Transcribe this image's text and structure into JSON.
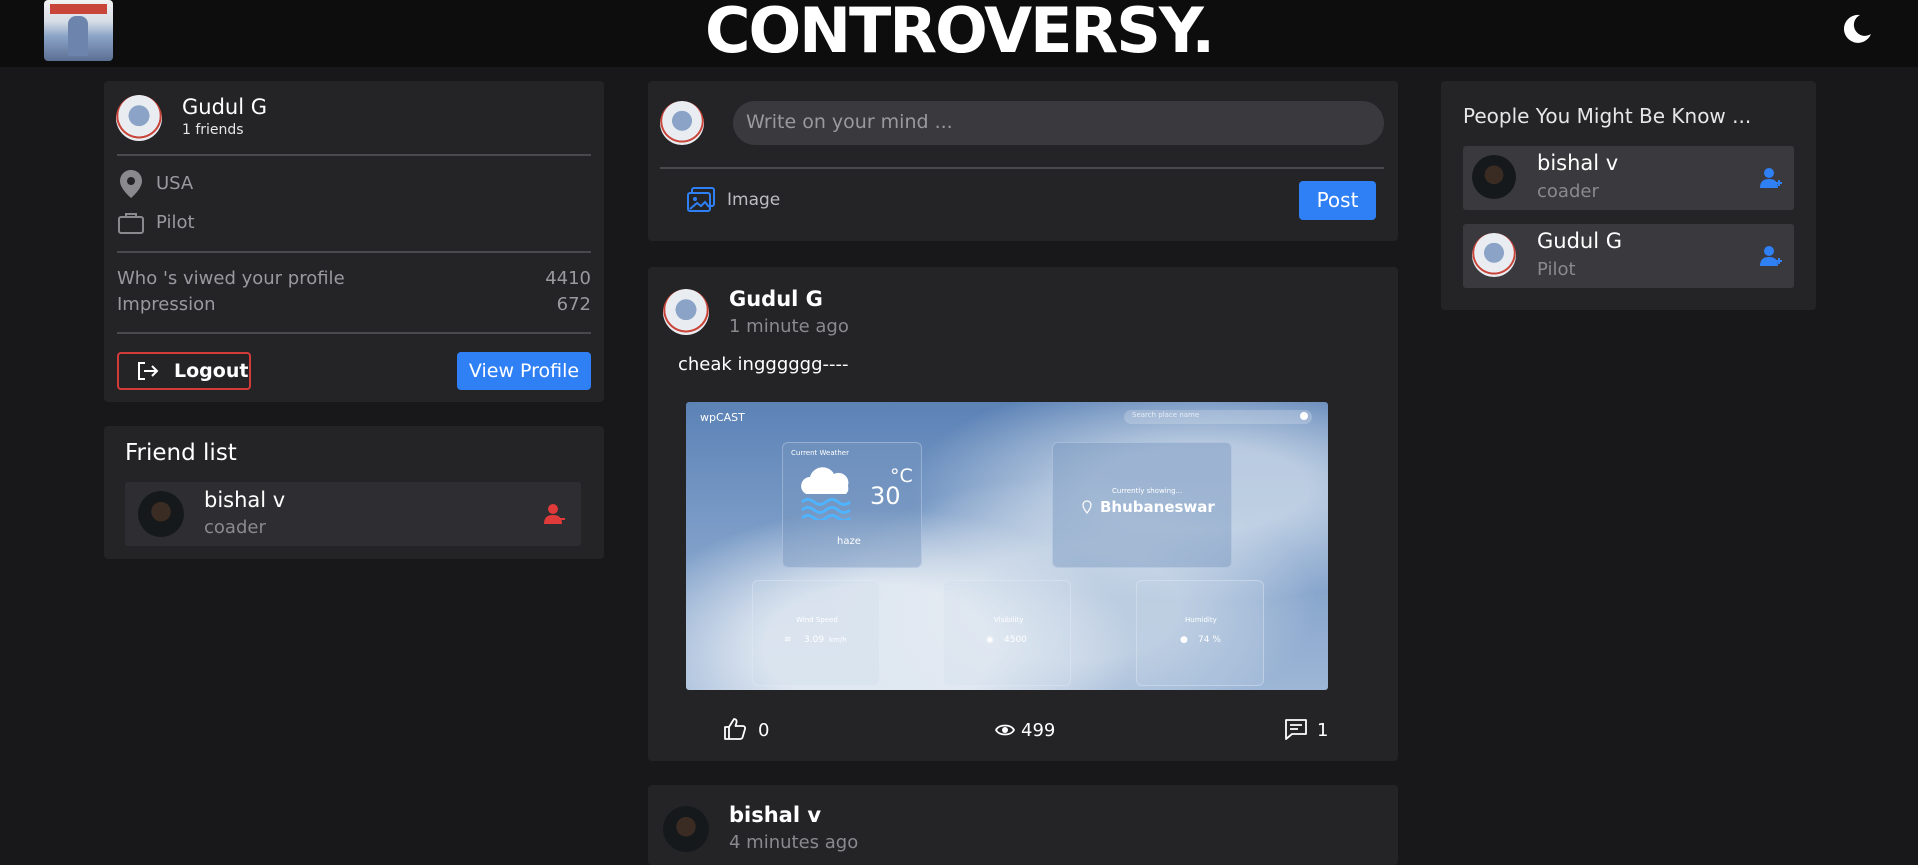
{
  "header": {
    "brand": "CONTROVERSY."
  },
  "profile_card": {
    "name": "Gudul G",
    "friends": "1 friends",
    "location": "USA",
    "job": "Pilot",
    "stats": [
      {
        "label": "Who 's viwed your profile",
        "value": "4410"
      },
      {
        "label": "Impression",
        "value": "672"
      }
    ],
    "logout_label": "Logout",
    "view_profile_label": "View Profile"
  },
  "friend_list": {
    "title": "Friend list",
    "items": [
      {
        "name": "bishal v",
        "job": "coader"
      }
    ]
  },
  "composer": {
    "placeholder": "Write on your mind ...",
    "image_label": "Image",
    "post_label": "Post"
  },
  "posts": [
    {
      "author": "Gudul G",
      "time": "1 minute ago",
      "text": "cheak ingggggg----",
      "likes": "0",
      "views": "499",
      "comments": "1",
      "image": {
        "app_name": "wpCAST",
        "search_placeholder": "Search place name",
        "current_weather_label": "Current Weather",
        "temperature": "30",
        "unit": "°C",
        "condition": "haze",
        "showing_label": "Currently showing...",
        "city": "Bhubaneswar",
        "wind_label": "Wind Speed",
        "wind_value": "3.09",
        "wind_unit": "km/h",
        "visibility_label": "Visibility",
        "visibility_value": "4500",
        "humidity_label": "Humidity",
        "humidity_value": "74 %"
      }
    },
    {
      "author": "bishal v",
      "time": "4 minutes ago"
    }
  ],
  "suggestions": {
    "title": "People You Might Be Know ...",
    "items": [
      {
        "name": "bishal v",
        "job": "coader"
      },
      {
        "name": "Gudul G",
        "job": "Pilot"
      }
    ]
  },
  "colors": {
    "accent": "#2f7ff5",
    "danger": "#d33a3a",
    "background": "#18181b",
    "card": "#242427"
  }
}
